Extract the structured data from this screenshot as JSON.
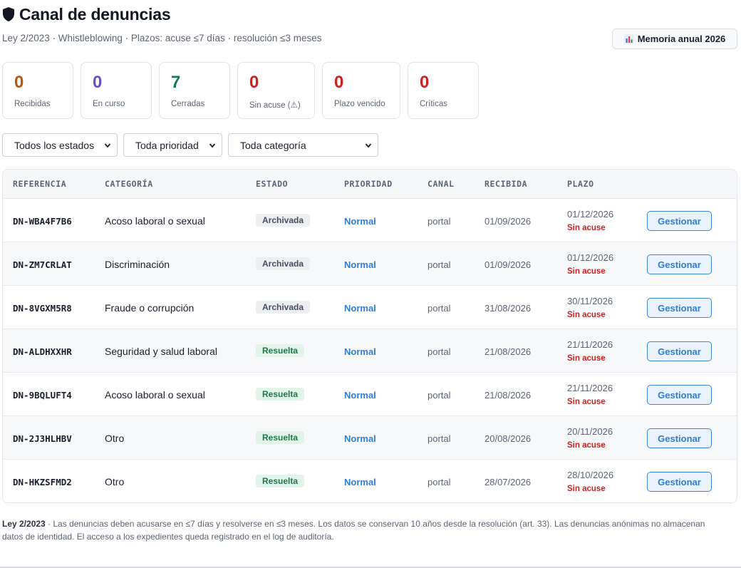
{
  "header": {
    "title": "Canal de denuncias",
    "subtitle": "Ley 2/2023 · Whistleblowing · Plazos: acuse ≤7 días · resolución ≤3 meses",
    "memoria_button": "Memoria anual 2026"
  },
  "stats": [
    {
      "value": "0",
      "label": "Recibidas",
      "color": "#b35a12"
    },
    {
      "value": "0",
      "label": "En curso",
      "color": "#6a4fc9"
    },
    {
      "value": "7",
      "label": "Cerradas",
      "color": "#177a4e"
    },
    {
      "value": "0",
      "label": "Sin acuse (⚠)",
      "color": "#d11f1f"
    },
    {
      "value": "0",
      "label": "Plazo vencido",
      "color": "#d11f1f"
    },
    {
      "value": "0",
      "label": "Críticas",
      "color": "#d11f1f"
    }
  ],
  "filters": {
    "estado": "Todos los estados",
    "prioridad": "Toda prioridad",
    "categoria": "Toda categoría"
  },
  "table": {
    "columns": [
      "REFERENCIA",
      "CATEGORÍA",
      "ESTADO",
      "PRIORIDAD",
      "CANAL",
      "RECIBIDA",
      "PLAZO"
    ],
    "action_label": "Gestionar",
    "rows": [
      {
        "ref": "DN-WBA4F7B6",
        "categoria": "Acoso laboral o sexual",
        "estado": "Archivada",
        "prioridad": "Normal",
        "canal": "portal",
        "recibida": "01/09/2026",
        "plazo": "01/12/2026",
        "alerta": "Sin acuse"
      },
      {
        "ref": "DN-ZM7CRLAT",
        "categoria": "Discriminación",
        "estado": "Archivada",
        "prioridad": "Normal",
        "canal": "portal",
        "recibida": "01/09/2026",
        "plazo": "01/12/2026",
        "alerta": "Sin acuse"
      },
      {
        "ref": "DN-8VGXM5R8",
        "categoria": "Fraude o corrupción",
        "estado": "Archivada",
        "prioridad": "Normal",
        "canal": "portal",
        "recibida": "31/08/2026",
        "plazo": "30/11/2026",
        "alerta": "Sin acuse"
      },
      {
        "ref": "DN-ALDHXXHR",
        "categoria": "Seguridad y salud laboral",
        "estado": "Resuelta",
        "prioridad": "Normal",
        "canal": "portal",
        "recibida": "21/08/2026",
        "plazo": "21/11/2026",
        "alerta": "Sin acuse"
      },
      {
        "ref": "DN-9BQLUFT4",
        "categoria": "Acoso laboral o sexual",
        "estado": "Resuelta",
        "prioridad": "Normal",
        "canal": "portal",
        "recibida": "21/08/2026",
        "plazo": "21/11/2026",
        "alerta": "Sin acuse"
      },
      {
        "ref": "DN-2J3HLHBV",
        "categoria": "Otro",
        "estado": "Resuelta",
        "prioridad": "Normal",
        "canal": "portal",
        "recibida": "20/08/2026",
        "plazo": "20/11/2026",
        "alerta": "Sin acuse"
      },
      {
        "ref": "DN-HKZSFMD2",
        "categoria": "Otro",
        "estado": "Resuelta",
        "prioridad": "Normal",
        "canal": "portal",
        "recibida": "28/07/2026",
        "plazo": "28/10/2026",
        "alerta": "Sin acuse"
      }
    ]
  },
  "footer": {
    "law": "Ley 2/2023",
    "text": " · Las denuncias deben acusarse en ≤7 días y resolverse en ≤3 meses. Los datos se conservan 10 años desde la resolución (art. 33). Las denuncias anónimas no almacenan datos de identidad. El acceso a los expedientes queda registrado en el log de auditoría."
  }
}
